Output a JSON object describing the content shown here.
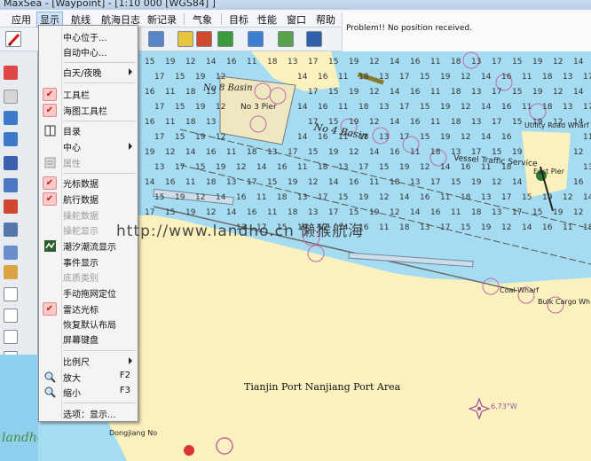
{
  "window": {
    "title": "MaxSea - [Waypoint] - [1:10 000 [WGS84] ]"
  },
  "menubar": [
    {
      "label": "应用"
    },
    {
      "label": "显示"
    },
    {
      "label": "航线"
    },
    {
      "label": "航海日志"
    },
    {
      "label": "新记录"
    },
    {
      "label": "气象"
    },
    {
      "label": "目标"
    },
    {
      "label": "性能"
    },
    {
      "label": "窗口"
    },
    {
      "label": "帮助"
    }
  ],
  "status": {
    "message": "Problem!! No position received."
  },
  "display_menu": {
    "items": [
      {
        "label": "中心位于...",
        "state": "normal"
      },
      {
        "label": "自动中心...",
        "state": "normal"
      },
      {
        "label": "白天/夜晚",
        "state": "submenu"
      },
      {
        "label": "工具栏",
        "state": "checked"
      },
      {
        "label": "海图工具栏",
        "state": "checked"
      },
      {
        "label": "目录",
        "state": "icon",
        "icon": "book-icon"
      },
      {
        "label": "中心",
        "state": "submenu"
      },
      {
        "label": "属性",
        "state": "disabled",
        "icon": "properties-icon"
      },
      {
        "label": "光标数据",
        "state": "checked"
      },
      {
        "label": "航行数据",
        "state": "checked"
      },
      {
        "label": "操舵数据",
        "state": "disabled"
      },
      {
        "label": "操舵显示",
        "state": "disabled"
      },
      {
        "label": "潮汐潮流显示",
        "state": "icon",
        "icon": "tide-icon"
      },
      {
        "label": "事件显示",
        "state": "normal"
      },
      {
        "label": "底质类别",
        "state": "disabled"
      },
      {
        "label": "手动拖网定位",
        "state": "normal"
      },
      {
        "label": "雷达光标",
        "state": "checked"
      },
      {
        "label": "恢复默认布局",
        "state": "normal"
      },
      {
        "label": "屏幕键盘",
        "state": "normal"
      },
      {
        "label": "比例尺",
        "state": "submenu"
      },
      {
        "label": "放大",
        "state": "icon",
        "icon": "zoom-in-icon",
        "shortcut": "F2"
      },
      {
        "label": "缩小",
        "state": "icon",
        "icon": "zoom-out-icon",
        "shortcut": "F3"
      },
      {
        "label": "选项：显示...",
        "state": "normal"
      }
    ]
  },
  "map": {
    "labels": {
      "port_area": "Tianjin Port Nanjiang Port Area",
      "north_basin": "No 4 Basin",
      "no8_basin": "No 8 Basin",
      "no3_pier": "No 3 Pier",
      "vts": "Vessel Traffic Service",
      "utility_road": "Utility Road Wharf",
      "east_pier": "East Pier",
      "coal_wharf": "Coal Wharf",
      "bulk_cargo": "Bulk Cargo Wh",
      "magvar": "6.73°W",
      "dongjiang": "Dongjiang No"
    },
    "soundings": [
      "15",
      "16",
      "17",
      "14",
      "13",
      "12",
      "18",
      "19",
      "11"
    ]
  },
  "watermark": {
    "text": "http://www.landho.cn  懒猴航海",
    "logo": "landho"
  },
  "colors": {
    "sea": "#a6dcf2",
    "land": "#fbf1bf",
    "check": "#c21818",
    "depth_circle": "#c06aa6"
  }
}
